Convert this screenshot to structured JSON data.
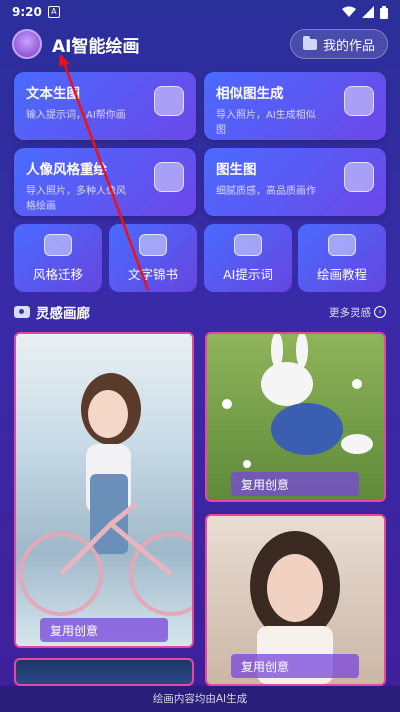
{
  "status": {
    "time": "9:20",
    "badge": "A"
  },
  "header": {
    "title": "AI智能绘画",
    "works_label": "我的作品"
  },
  "features": [
    {
      "title": "文本生图",
      "desc": "输入提示词，AI帮你画",
      "icon": "text-to-image-icon"
    },
    {
      "title": "相似图生成",
      "desc": "导入照片，AI生成相似图",
      "icon": "similar-image-icon"
    },
    {
      "title": "人像风格重绘",
      "desc": "导入照片，多种人像风格绘画",
      "icon": "portrait-style-icon"
    },
    {
      "title": "图生图",
      "desc": "细腻质感，高品质画作",
      "icon": "image-to-image-icon"
    }
  ],
  "tiles": [
    {
      "label": "风格迁移",
      "icon": "style-transfer-icon"
    },
    {
      "label": "文字锦书",
      "icon": "text-brocade-icon"
    },
    {
      "label": "AI提示词",
      "icon": "ai-prompt-icon"
    },
    {
      "label": "绘画教程",
      "icon": "drawing-tutorial-icon"
    }
  ],
  "inspiration": {
    "title": "灵感画廊",
    "more": "更多灵感",
    "reuse_label": "复用创意"
  },
  "footer": {
    "text": "绘画内容均由AI生成"
  },
  "colors": {
    "accent": "#4a6bff",
    "card_border": "#e34a9d"
  }
}
